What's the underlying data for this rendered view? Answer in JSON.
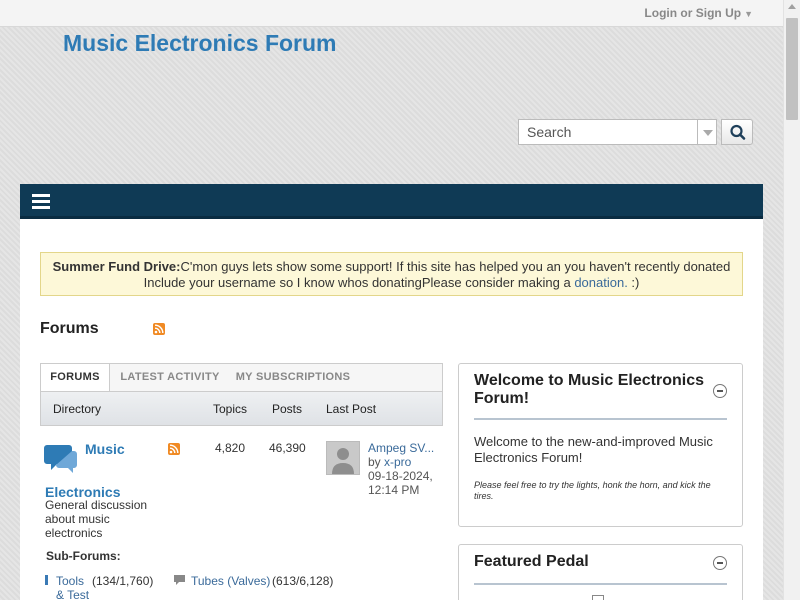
{
  "header": {
    "login_label": "Login or Sign Up",
    "site_title": "Music Electronics Forum"
  },
  "search": {
    "placeholder": "Search"
  },
  "notice": {
    "label": "Summer Fund Drive:",
    "text": "C'mon guys lets show some support! If this site has helped you an you haven't recently donated Include your username so I know whos donatingPlease consider making a ",
    "link": "donation.",
    "suffix": " :)"
  },
  "forums": {
    "heading": "Forums",
    "tabs": [
      {
        "label": "FORUMS"
      },
      {
        "label": "LATEST ACTIVITY"
      },
      {
        "label": "MY SUBSCRIPTIONS"
      }
    ],
    "columns": {
      "directory": "Directory",
      "topics": "Topics",
      "posts": "Posts",
      "last_post": "Last Post"
    },
    "rows": [
      {
        "name_part1": "Music",
        "name_part2": "Electronics",
        "description": "General discussion about music electronics",
        "topics": "4,820",
        "posts": "46,390",
        "last_post_title": "Ampeg SV...",
        "last_post_by": "by ",
        "last_post_user": "x-pro",
        "last_post_date": "09-18-2024,",
        "last_post_time": "12:14 PM"
      }
    ],
    "subforums_label": "Sub-Forums:",
    "subforums": [
      {
        "name": "Tools & Test",
        "count": "(134/1,760)"
      },
      {
        "name": "Tubes (Valves)",
        "count": "(613/6,128)"
      }
    ]
  },
  "widgets": {
    "welcome": {
      "title": "Welcome to Music Electronics Forum!",
      "body": "Welcome to the new-and-improved Music Electronics Forum!",
      "small": "Please feel free to try the lights, honk the horn, and kick the tires."
    },
    "featured": {
      "title": "Featured Pedal"
    }
  },
  "colors": {
    "brand": "#2e7bb5",
    "navbar": "#0f3a55",
    "notice_bg": "#fdf8d8"
  },
  "icons": {
    "rss": "rss-icon",
    "search": "search-icon",
    "menu": "hamburger-menu-icon",
    "forum": "chat-bubble-icon"
  }
}
